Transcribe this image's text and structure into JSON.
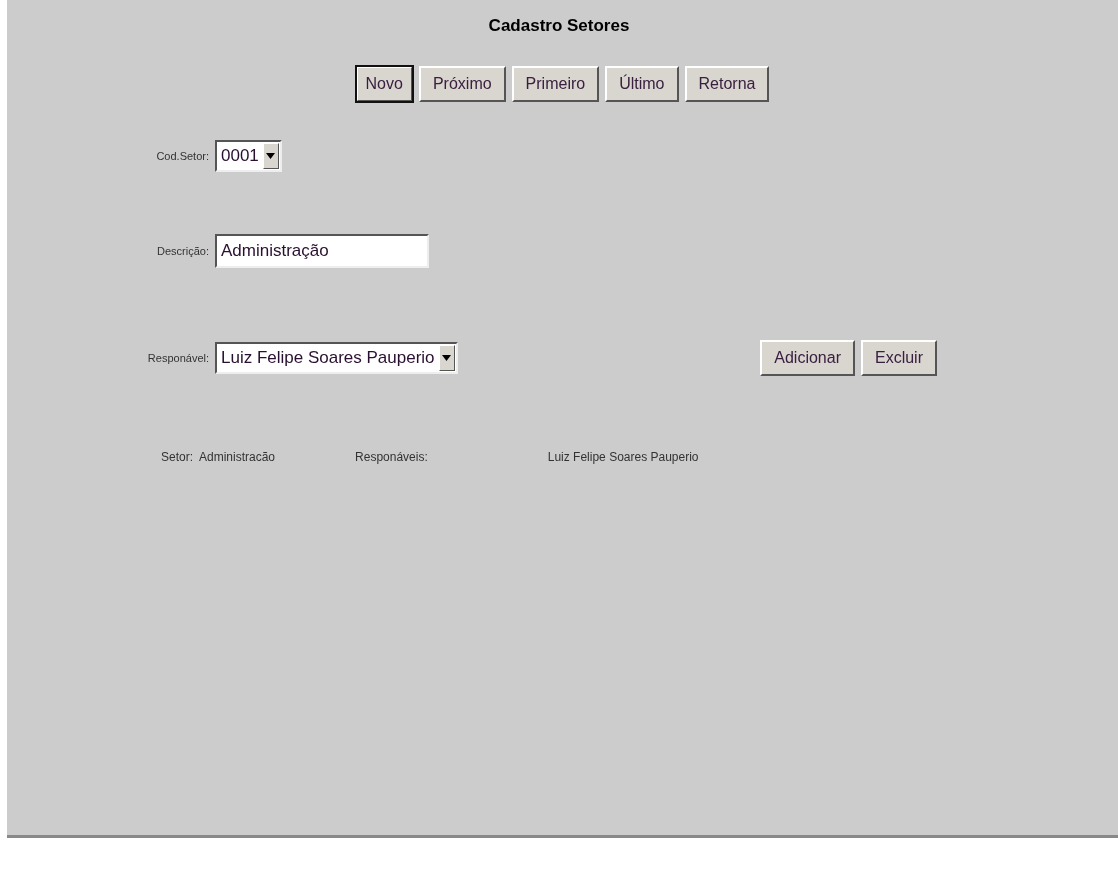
{
  "title": "Cadastro Setores",
  "nav_buttons": [
    {
      "label": "Novo",
      "focused": true
    },
    {
      "label": "Próximo",
      "focused": false
    },
    {
      "label": "Primeiro",
      "focused": false
    },
    {
      "label": "Último",
      "focused": false
    },
    {
      "label": "Retorna",
      "focused": false
    }
  ],
  "cod_setor": {
    "label": "Cod.Setor:",
    "value": "0001"
  },
  "descricao": {
    "label": "Descrição:",
    "value": "Administração"
  },
  "responsavel": {
    "label": "Responável:",
    "value": "Luiz Felipe Soares Pauperio"
  },
  "action_buttons": [
    "Adicionar",
    "Excluir"
  ],
  "summary": {
    "setor_label": "Setor:",
    "setor_value": "Administracão",
    "responsaveis_label": "Responáveis:",
    "responsaveis_value": "Luiz Felipe Soares Pauperio"
  }
}
